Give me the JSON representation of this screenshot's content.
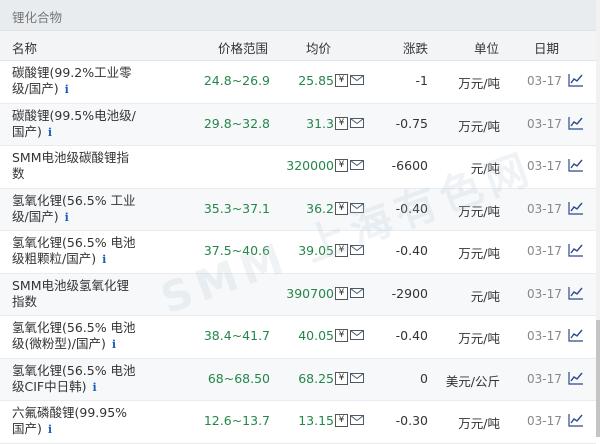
{
  "section": {
    "title": "锂化合物"
  },
  "columns": {
    "name": "名称",
    "range": "价格范围",
    "avg": "均价",
    "change": "涨跌",
    "unit": "单位",
    "date": "日期"
  },
  "icons": {
    "yen": "¥",
    "info": "i",
    "mail": "mail-icon",
    "trend": "trend-chart-icon"
  },
  "watermark": "SMM 上海有色网",
  "rows": [
    {
      "name": "碳酸锂(99.2%工业零级/国产)",
      "range": "24.8~26.9",
      "avg": "25.85",
      "change": "-1",
      "unit": "万元/吨",
      "date": "03-17"
    },
    {
      "name": "碳酸锂(99.5%电池级/国产)",
      "range": "29.8~32.8",
      "avg": "31.3",
      "change": "-0.75",
      "unit": "万元/吨",
      "date": "03-17"
    },
    {
      "name": "SMM电池级碳酸锂指数",
      "range": "",
      "avg": "320000",
      "change": "-6600",
      "unit": "元/吨",
      "date": "03-17"
    },
    {
      "name": "氢氧化锂(56.5% 工业级/国产)",
      "range": "35.3~37.1",
      "avg": "36.2",
      "change": "-0.40",
      "unit": "万元/吨",
      "date": "03-17"
    },
    {
      "name": "氢氧化锂(56.5% 电池级粗颗粒/国产)",
      "range": "37.5~40.6",
      "avg": "39.05",
      "change": "-0.40",
      "unit": "万元/吨",
      "date": "03-17"
    },
    {
      "name": "SMM电池级氢氧化锂指数",
      "range": "",
      "avg": "390700",
      "change": "-2900",
      "unit": "元/吨",
      "date": "03-17"
    },
    {
      "name": "氢氧化锂(56.5% 电池级(微粉型)/国产)",
      "range": "38.4~41.7",
      "avg": "40.05",
      "change": "-0.40",
      "unit": "万元/吨",
      "date": "03-17"
    },
    {
      "name": "氢氧化锂(56.5% 电池级CIF中日韩)",
      "range": "68~68.50",
      "avg": "68.25",
      "change": "0",
      "unit": "美元/公斤",
      "date": "03-17"
    },
    {
      "name": "六氟磷酸锂(99.95%国产)",
      "range": "12.6~13.7",
      "avg": "13.15",
      "change": "-0.30",
      "unit": "万元/吨",
      "date": "03-17"
    }
  ],
  "row_info_icon": [
    true,
    true,
    false,
    true,
    true,
    false,
    true,
    true,
    true
  ],
  "colors": {
    "price_green": "#26864a",
    "header_bg": "#e9ecef",
    "info_blue": "#1f5fb5"
  }
}
